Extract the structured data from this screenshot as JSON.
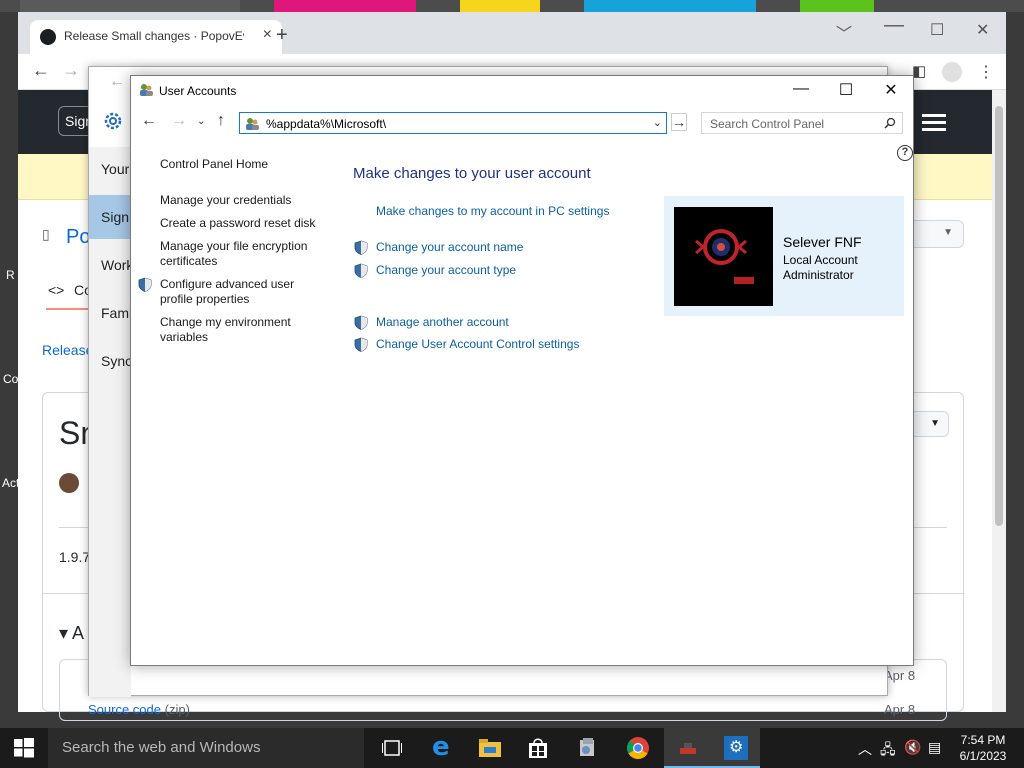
{
  "chrome": {
    "tab_title": "Release Small changes · PopovEv",
    "tab_close": "×",
    "new_tab": "+",
    "back": "←",
    "forward": "→",
    "minimize": "﹀",
    "restore": "☐",
    "close": "✕"
  },
  "github": {
    "signin": "Sign",
    "repo_prefix": "Po",
    "code_tab": "Co",
    "breadcrumb": "Release",
    "release_title": "Sm",
    "version": "1.9.7",
    "assets_heading": "A",
    "asset_date_1": "Apr 8",
    "asset_source": "Source code",
    "asset_source_ext": "(zip)",
    "asset_date_2": "Apr 8"
  },
  "settings": {
    "nav": [
      "Your",
      "Sign",
      "Work",
      "Fami",
      "Sync"
    ]
  },
  "user_accounts": {
    "title": "User Accounts",
    "minimize": "—",
    "maximize": "☐",
    "close": "✕",
    "address": "%appdata%\\Microsoft\\",
    "search_placeholder": "Search Control Panel",
    "help": "?",
    "sidebar": {
      "home": "Control Panel Home",
      "links": [
        "Manage your credentials",
        "Create a password reset disk",
        "Manage your file encryption certificates",
        "Configure advanced user profile properties",
        "Change my environment variables"
      ]
    },
    "heading": "Make changes to your user account",
    "pc_settings_link": "Make changes to my account in PC settings",
    "actions": [
      "Change your account name",
      "Change your account type",
      "Manage another account",
      "Change User Account Control settings"
    ],
    "account": {
      "name": "Selever FNF",
      "type": "Local Account",
      "role": "Administrator"
    }
  },
  "taskbar": {
    "search_placeholder": "Search the web and Windows",
    "time": "7:54 PM",
    "date": "6/1/2023"
  },
  "desktop_labels": [
    "R",
    "Co",
    "Act"
  ]
}
